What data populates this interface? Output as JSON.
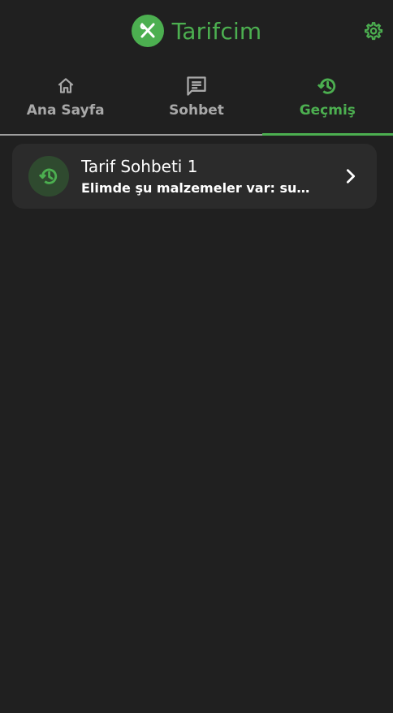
{
  "header": {
    "app_title": "Tarifcim",
    "logo_icon": "fork-knife-icon",
    "settings_icon": "gear-icon"
  },
  "tabs": [
    {
      "label": "Ana Sayfa",
      "icon": "home-icon",
      "active": false
    },
    {
      "label": "Sohbet",
      "icon": "chat-icon",
      "active": false
    },
    {
      "label": "Geçmiş",
      "icon": "history-icon",
      "active": true
    }
  ],
  "history": {
    "items": [
      {
        "title": "Tarif Sohbeti 1",
        "snippet": "Elimde şu malzemeler var: sucuk",
        "icon": "history-icon",
        "action_icon": "chevron-right-icon"
      }
    ]
  },
  "colors": {
    "background": "#202020",
    "accent": "#4caf50",
    "card": "#2b2b2b",
    "inactive": "#a8a8a8"
  }
}
